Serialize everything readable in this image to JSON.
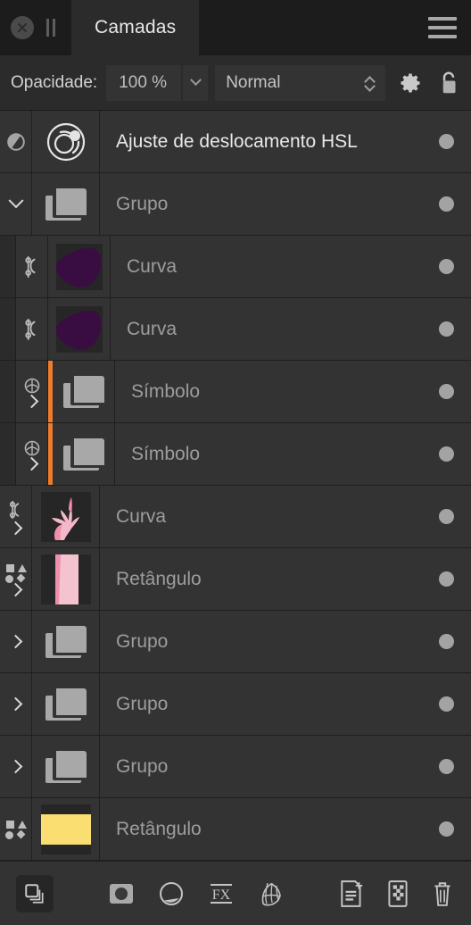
{
  "window": {
    "title": "Camadas",
    "close_icon": "close-circle-icon",
    "grip_icon": "panel-grip-icon",
    "menu_icon": "hamburger-menu-icon"
  },
  "options": {
    "opacity_label": "Opacidade:",
    "opacity_value": "100 %",
    "opacity_dropdown_icon": "chevron-down-icon",
    "blend_mode": "Normal",
    "blend_stepper_icon": "spinner-updown-icon",
    "settings_icon": "gear-icon",
    "lock_icon": "unlocked-padlock-icon"
  },
  "layers": [
    {
      "name": "Ajuste de deslocamento HSL",
      "type": "adjustment",
      "indent": 0,
      "icon": "hsl-adjustment-icon",
      "ctrl_icon": "contrast-half-circle-icon",
      "expander": "",
      "thumb": "hsl-wheel",
      "visible_dot": true,
      "bright": true
    },
    {
      "name": "Grupo",
      "type": "group",
      "indent": 0,
      "icon": "folder-icon",
      "ctrl_icon": "",
      "expander": "chevron-down-icon",
      "thumb": "folder",
      "visible_dot": true,
      "bright": false
    },
    {
      "name": "Curva",
      "type": "curve",
      "indent": 1,
      "icon": "curve-node-icon",
      "ctrl_icon": "curve-node-icon",
      "expander": "",
      "thumb": "purple-blob",
      "visible_dot": true,
      "bright": false
    },
    {
      "name": "Curva",
      "type": "curve",
      "indent": 1,
      "icon": "curve-node-icon",
      "ctrl_icon": "curve-node-icon",
      "expander": "",
      "thumb": "purple-blob",
      "visible_dot": true,
      "bright": false
    },
    {
      "name": "Símbolo",
      "type": "symbol",
      "indent": 1,
      "icon": "folder-icon",
      "ctrl_icon": "symbol-icon",
      "expander": "chevron-right-icon",
      "thumb": "folder",
      "marker_color": "#f07c2b",
      "visible_dot": true,
      "bright": false
    },
    {
      "name": "Símbolo",
      "type": "symbol",
      "indent": 1,
      "icon": "folder-icon",
      "ctrl_icon": "symbol-icon",
      "expander": "chevron-right-icon",
      "thumb": "folder",
      "marker_color": "#f07c2b",
      "visible_dot": true,
      "bright": false
    },
    {
      "name": "Curva",
      "type": "curve",
      "indent": 0,
      "icon": "curve-node-icon",
      "ctrl_icon": "curve-node-icon",
      "expander": "chevron-right-icon",
      "thumb": "pink-arm",
      "visible_dot": true,
      "bright": false
    },
    {
      "name": "Retângulo",
      "type": "rectangle",
      "indent": 0,
      "icon": "shapes-icon",
      "ctrl_icon": "shapes-icon",
      "expander": "chevron-right-icon",
      "thumb": "pink-stripe",
      "visible_dot": true,
      "bright": false
    },
    {
      "name": "Grupo",
      "type": "group",
      "indent": 0,
      "icon": "folder-icon",
      "ctrl_icon": "",
      "expander": "chevron-right-icon",
      "thumb": "folder",
      "visible_dot": true,
      "bright": false
    },
    {
      "name": "Grupo",
      "type": "group",
      "indent": 0,
      "icon": "folder-icon",
      "ctrl_icon": "",
      "expander": "chevron-right-icon",
      "thumb": "folder",
      "visible_dot": true,
      "bright": false
    },
    {
      "name": "Grupo",
      "type": "group",
      "indent": 0,
      "icon": "folder-icon",
      "ctrl_icon": "",
      "expander": "chevron-right-icon",
      "thumb": "folder",
      "visible_dot": true,
      "bright": false
    },
    {
      "name": "Retângulo",
      "type": "rectangle",
      "indent": 0,
      "icon": "shapes-icon",
      "ctrl_icon": "shapes-icon",
      "expander": "",
      "thumb": "yellow-rect",
      "visible_dot": true,
      "bright": false
    }
  ],
  "toolbar": {
    "mask_icon": "add-mask-icon",
    "adjustment_icon": "add-adjustment-icon",
    "fx_icon": "layer-effects-fx-icon",
    "livefilter_icon": "live-filter-mesh-icon",
    "new_layer_icon": "new-layer-icon",
    "new_pixel_layer_icon": "new-pixel-layer-icon",
    "delete_icon": "trash-delete-icon",
    "layers_toggle_icon": "layers-stack-icon"
  },
  "colors": {
    "accent_orange": "#f07c2b",
    "panel_bg": "#2b2b2b",
    "row_bg": "#333333",
    "tabbar_bg": "#1c1c1c",
    "thumb_purple": "#3a0d42",
    "thumb_pink": "#f4b8c8",
    "thumb_pink_dark": "#ef8fad",
    "thumb_yellow": "#fade72",
    "text_primary": "#e9e9e9",
    "text_secondary": "#9d9d9d"
  }
}
